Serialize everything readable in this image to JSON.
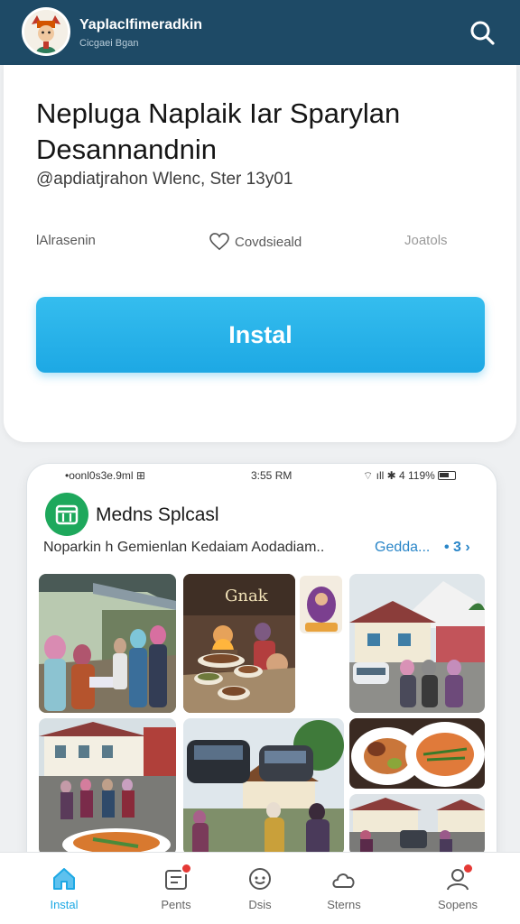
{
  "topbar": {
    "app_name": "Yaplaclfimeradkin",
    "subtitle": "Cicgaei Bgan",
    "icon": "search-icon"
  },
  "app": {
    "title": "Nepluga Naplaik Iar Sparylan Desannandnin",
    "developer": "@apdiatjrahon Wlenc, Ster 13y01",
    "meta_left": "lAlrasenin",
    "meta_mid": "Covdsieald",
    "meta_right": "Joatols",
    "install_label": "Instal",
    "install_color": "#1da8e4"
  },
  "phone": {
    "status_left": "•oonl0s3e.9ml ⊞",
    "status_time": "3:55 RM",
    "status_right": "⌔ ıll ✱ 4 119%",
    "inner_app_name": "Medns Splcasl",
    "inner_subtitle": "Noparkin h  Gemienlan Kedaiam Aodadiam..",
    "inner_link": "Gedda...",
    "inner_link_arrow": "• 3 ›",
    "inner_icon": "calendar-icon",
    "inner_icon_color": "#1ea85c"
  },
  "photos": [
    {
      "name": "photo-market-queue",
      "icon": "photo"
    },
    {
      "name": "photo-food-bowls",
      "icon": "photo"
    },
    {
      "name": "photo-sign-inset",
      "icon": "photo"
    },
    {
      "name": "photo-building-cars",
      "icon": "photo"
    },
    {
      "name": "photo-street-crowd",
      "icon": "photo"
    },
    {
      "name": "photo-parked-cars",
      "icon": "photo"
    },
    {
      "name": "photo-food-plate",
      "icon": "photo"
    },
    {
      "name": "photo-street-houses",
      "icon": "photo"
    }
  ],
  "nav": {
    "items": [
      {
        "label": "Instal",
        "icon": "home-icon",
        "active": true
      },
      {
        "label": "Pents",
        "icon": "inbox-icon",
        "active": false
      },
      {
        "label": "Dsis",
        "icon": "chat-icon",
        "active": false
      },
      {
        "label": "Sterns",
        "icon": "cloud-icon",
        "active": false
      },
      {
        "label": "Sopens",
        "icon": "user-icon",
        "active": false
      }
    ]
  }
}
